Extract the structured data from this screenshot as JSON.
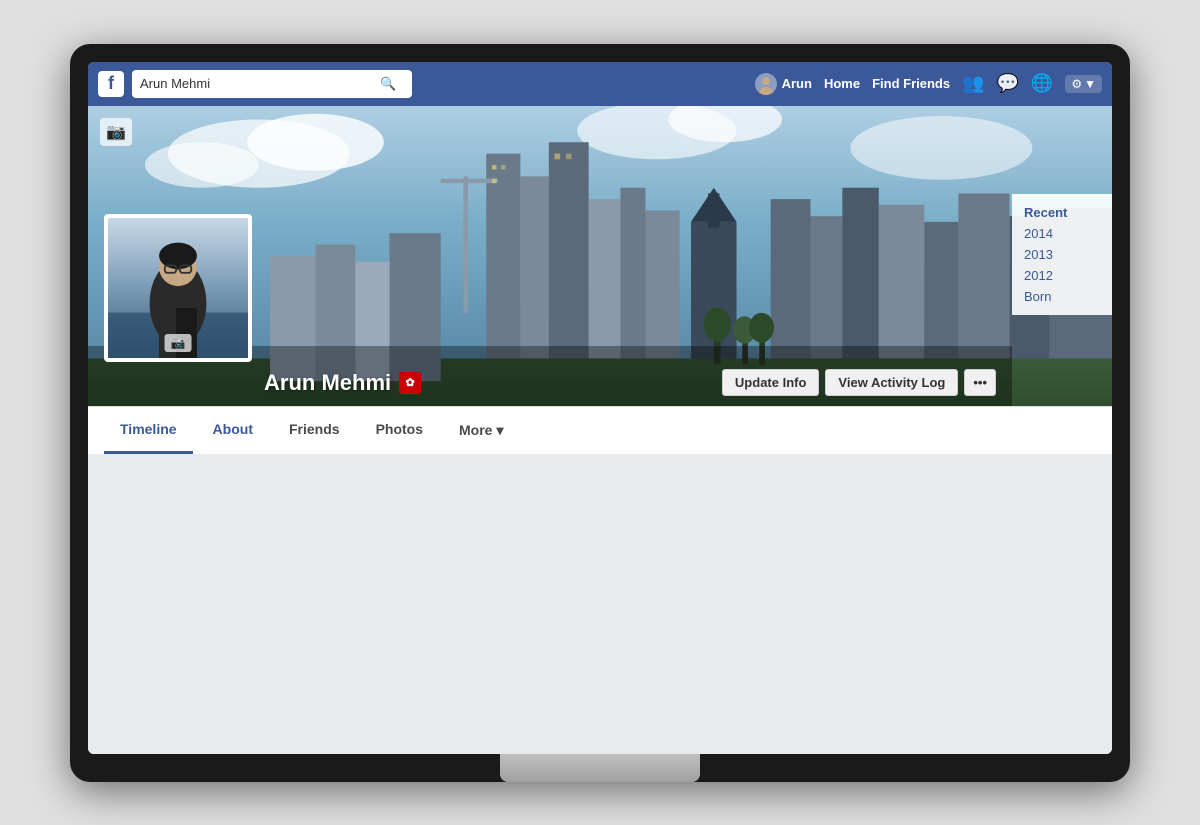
{
  "monitor": {
    "screen_bg": "#f0f0f0"
  },
  "navbar": {
    "logo": "f",
    "search_placeholder": "Arun Mehmi",
    "search_value": "Arun Mehmi",
    "user_name": "Arun",
    "nav_links": [
      "Home",
      "Find Friends"
    ],
    "icons": [
      "friends-requests-icon",
      "messages-icon",
      "notifications-icon"
    ],
    "settings_label": "⚙",
    "dropdown_arrow": "▼"
  },
  "timeline": {
    "sidebar_items": [
      {
        "label": "Recent",
        "type": "recent"
      },
      {
        "label": "2014",
        "type": "year"
      },
      {
        "label": "2013",
        "type": "year"
      },
      {
        "label": "2012",
        "type": "year"
      },
      {
        "label": "Born",
        "type": "year"
      }
    ]
  },
  "profile": {
    "name": "Arun Mehmi",
    "badge_symbol": "✿",
    "cover_camera_symbol": "📷",
    "profile_camera_symbol": "📷",
    "buttons": {
      "update_info": "Update Info",
      "view_activity_log": "View Activity Log",
      "more_dots": "•••"
    },
    "tabs": [
      {
        "label": "Timeline",
        "active": true
      },
      {
        "label": "About",
        "active": false
      },
      {
        "label": "Friends",
        "active": false
      },
      {
        "label": "Photos",
        "active": false
      },
      {
        "label": "More",
        "has_arrow": true
      }
    ]
  }
}
